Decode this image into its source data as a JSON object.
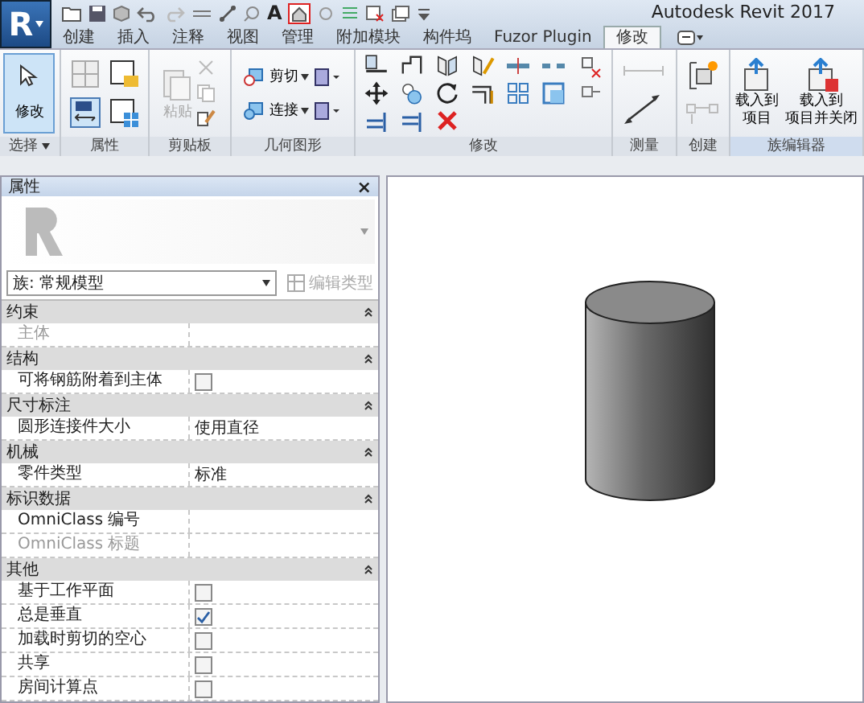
{
  "app": {
    "logo": "R",
    "title": "Autodesk Revit 2017",
    "quick_access_text": "A"
  },
  "tabs": [
    {
      "label": "创建",
      "selected": false
    },
    {
      "label": "插入",
      "selected": false
    },
    {
      "label": "注释",
      "selected": false
    },
    {
      "label": "视图",
      "selected": false
    },
    {
      "label": "管理",
      "selected": false
    },
    {
      "label": "附加模块",
      "selected": false
    },
    {
      "label": "构件坞",
      "selected": false
    },
    {
      "label": "Fuzor Plugin",
      "selected": false
    },
    {
      "label": "修改",
      "selected": true
    }
  ],
  "ribbon": {
    "modify_button": {
      "label": "修改",
      "selected": true
    },
    "paste_button": {
      "label": "粘贴",
      "disabled": true
    },
    "geometry_items": [
      {
        "label": "剪切"
      },
      {
        "label": "连接"
      }
    ],
    "family_editor": [
      {
        "label_lines": [
          "载入到",
          "项目"
        ]
      },
      {
        "label_lines": [
          "载入到",
          "项目并关闭"
        ]
      }
    ],
    "panels": [
      {
        "label": "选择",
        "dropdown": true,
        "kind": "select"
      },
      {
        "label": "属性",
        "dropdown": false,
        "kind": "properties"
      },
      {
        "label": "剪贴板",
        "dropdown": false,
        "kind": "clipboard"
      },
      {
        "label": "几何图形",
        "dropdown": false,
        "kind": "geometry"
      },
      {
        "label": "修改",
        "dropdown": false,
        "kind": "modify"
      },
      {
        "label": "测量",
        "dropdown": false,
        "kind": "measure"
      },
      {
        "label": "创建",
        "dropdown": false,
        "kind": "create"
      },
      {
        "label": "族编辑器",
        "dropdown": false,
        "kind": "family"
      }
    ]
  },
  "properties": {
    "title": "属性",
    "close": "×",
    "type_selector": "族: 常规模型",
    "edit_type": {
      "label": "编辑类型",
      "disabled": true
    },
    "groups": [
      {
        "name": "约束",
        "rows": [
          {
            "label": "主体",
            "kind": "text",
            "value": "",
            "disabled": true
          }
        ]
      },
      {
        "name": "结构",
        "rows": [
          {
            "label": "可将钢筋附着到主体",
            "kind": "checkbox",
            "checked": false,
            "disabled": false
          }
        ]
      },
      {
        "name": "尺寸标注",
        "rows": [
          {
            "label": "圆形连接件大小",
            "kind": "text",
            "value": "使用直径",
            "disabled": false
          }
        ]
      },
      {
        "name": "机械",
        "rows": [
          {
            "label": "零件类型",
            "kind": "text",
            "value": "标准",
            "disabled": false
          }
        ]
      },
      {
        "name": "标识数据",
        "rows": [
          {
            "label": "OmniClass 编号",
            "kind": "text",
            "value": "",
            "disabled": false
          },
          {
            "label": "OmniClass 标题",
            "kind": "text",
            "value": "",
            "disabled": true
          }
        ]
      },
      {
        "name": "其他",
        "rows": [
          {
            "label": "基于工作平面",
            "kind": "checkbox",
            "checked": false,
            "disabled": false
          },
          {
            "label": "总是垂直",
            "kind": "checkbox",
            "checked": true,
            "disabled": false
          },
          {
            "label": "加载时剪切的空心",
            "kind": "checkbox",
            "checked": false,
            "disabled": false
          },
          {
            "label": "共享",
            "kind": "checkbox",
            "checked": false,
            "disabled": false
          },
          {
            "label": "房间计算点",
            "kind": "checkbox",
            "checked": false,
            "disabled": false
          }
        ]
      }
    ]
  }
}
